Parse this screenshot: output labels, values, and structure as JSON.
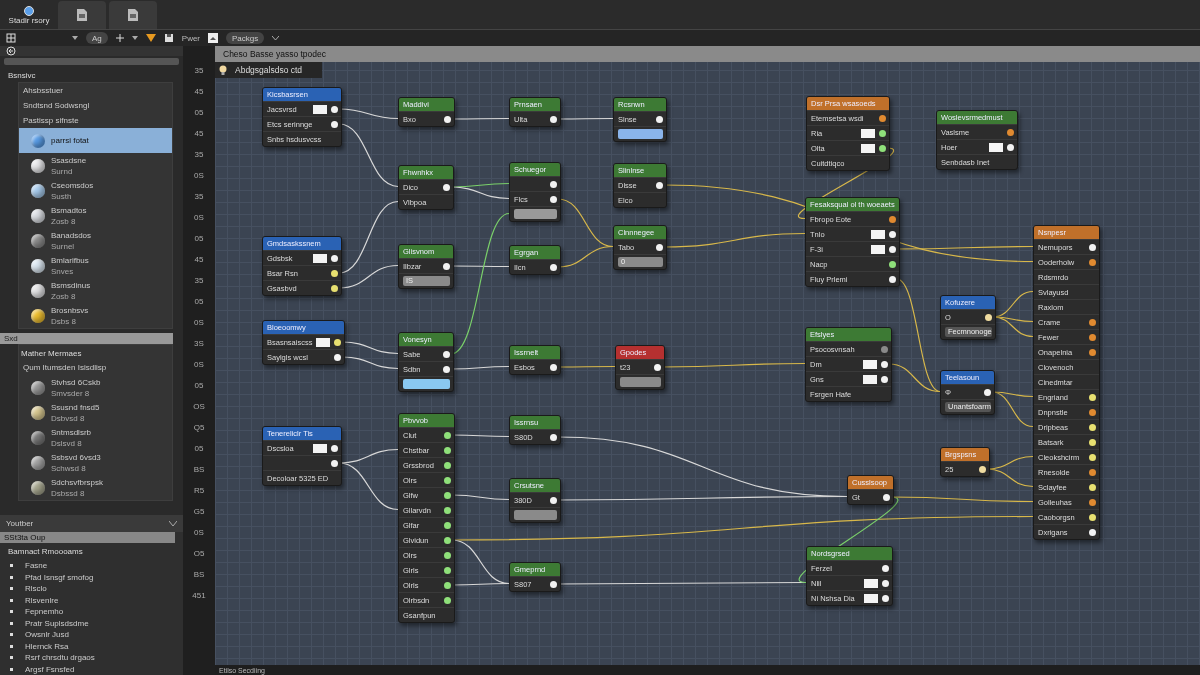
{
  "app_bar": {
    "title": "Stadir rsory"
  },
  "toolbar": {
    "zoom": "Ag",
    "toggle_label": "Pwer",
    "dropdown": "Packgs"
  },
  "left_panel": {
    "section": "Bsnsivc",
    "materials": [
      {
        "kind": "text",
        "name": "Ahsbsstuer",
        "selected": false
      },
      {
        "kind": "text",
        "name": "Sndtsnd Sodwsngl",
        "selected": false
      },
      {
        "kind": "text",
        "name": "Pastissp sifnste",
        "selected": false
      },
      {
        "kind": "sphere",
        "name": "parrsi fotat",
        "color": "#5a9ee8",
        "selected": true
      },
      {
        "kind": "sphere",
        "name": "Ssasdsne",
        "sub": "Surnd",
        "color": "#e8e8ea",
        "selected": false
      },
      {
        "kind": "sphere",
        "name": "Cseomsdos",
        "sub": "Susth",
        "color": "#a8ccee",
        "selected": false
      },
      {
        "kind": "sphere",
        "name": "Bsmadtos",
        "sub": "Zosb 8",
        "color": "#dcdfe4",
        "selected": false
      },
      {
        "kind": "sphere",
        "name": "Banadsdos",
        "sub": "Surnel",
        "color": "#8c8c8c",
        "selected": false
      },
      {
        "kind": "sphere",
        "name": "Bmlarifbus",
        "sub": "Snves",
        "color": "#dce8f2",
        "selected": false
      },
      {
        "kind": "sphere",
        "name": "Bsmsdinus",
        "sub": "Zosb 8",
        "color": "#e4e4e6",
        "selected": false
      },
      {
        "kind": "sphere",
        "name": "Brosnbsvs",
        "sub": "Dsbs 8",
        "color": "#f0c030",
        "selected": false
      }
    ]
  },
  "library": {
    "bar": "Sxd",
    "heading": "Mather Mermaes",
    "items": [
      {
        "kind": "text",
        "name": "Qum Itumsden Isisdlisp",
        "selected": false
      },
      {
        "kind": "sphere",
        "name": "Stvhsd 6Cskb",
        "sub": "Smvsder 8",
        "color": "#9a9a9a",
        "selected": false
      },
      {
        "kind": "sphere",
        "name": "Ssusnd fnsd5",
        "sub": "Dsbvsd 8",
        "color": "#d8c890",
        "selected": false
      },
      {
        "kind": "sphere",
        "name": "Sntmsdlsrb",
        "sub": "Dslsvd 8",
        "color": "#7a7a7a",
        "selected": false
      },
      {
        "kind": "sphere",
        "name": "Ssbsvd 6vsd3",
        "sub": "Schwsd 8",
        "color": "#a4a4a4",
        "selected": false
      },
      {
        "kind": "sphere",
        "name": "Sdchsvfbrspsk",
        "sub": "Dsbssd 8",
        "color": "#a8a890",
        "selected": false
      }
    ]
  },
  "notes_panel": {
    "title": "Youtber",
    "bar": "SSt3ta Oup",
    "heading": "Bamnact Rmoooams",
    "items": [
      "Fasne",
      "Pfad Isnsgf smofog",
      "Rlsclo",
      "Rlsvenlre",
      "Fepnemho",
      "Pratr Suplsdsdme",
      "Owsnlr Jusd",
      "Hlernck Rsa",
      "Rsrf chrsdtu drgaos",
      "Argsf Fsnsfed"
    ]
  },
  "ruler": [
    "35",
    "45",
    "05",
    "45",
    "35",
    "0S",
    "35",
    "0S",
    "05",
    "45",
    "35",
    "05",
    "0S",
    "3S",
    "0S",
    "05",
    "OS",
    "Q5",
    "05",
    "BS",
    "R5",
    "G5",
    "0S",
    "O5",
    "BS",
    "451"
  ],
  "canvas": {
    "breadcrumb": "Cheso Basse yasso tpodec",
    "subtitle": "Abdgsgalsdso ctd",
    "nodes": [
      {
        "title": "Kicsbasrsen",
        "color": "#2a62b4",
        "rows": [
          {
            "kind": "swatch",
            "label": "Jacsvrsd",
            "color": "#f2f2f2"
          },
          {
            "kind": "pin",
            "label": "Etcs serinnge",
            "color": "#f2f2f2"
          },
          {
            "kind": "text",
            "label": "Snbs hsdusvcss"
          }
        ]
      },
      {
        "title": "Maddivi",
        "color": "#3d7a34",
        "rows": [
          {
            "kind": "pin",
            "label": "Bxo",
            "color": "#f2f2f2"
          }
        ]
      },
      {
        "title": "Prnsaen",
        "color": "#3d7a34",
        "rows": [
          {
            "kind": "pin",
            "label": "Ulta",
            "color": "#f2f2f2"
          }
        ]
      },
      {
        "title": "Rcsnwn",
        "color": "#3d7a34",
        "rows": [
          {
            "kind": "pin",
            "label": "Slnse",
            "color": "#f2f2f2"
          },
          {
            "kind": "bar",
            "label": "",
            "color": "#8ab4ea"
          }
        ]
      },
      {
        "title": "Fhwnhkx",
        "color": "#3d7a34",
        "rows": [
          {
            "kind": "pin",
            "label": "Dico",
            "color": "#f2f2f2"
          },
          {
            "kind": "text",
            "label": "Vlbpoa"
          }
        ]
      },
      {
        "title": "Schuegor",
        "color": "#3d7a34",
        "rows": [
          {
            "kind": "pin",
            "label": "",
            "color": "#f2f2f2"
          },
          {
            "kind": "pin",
            "label": "Flcs",
            "color": "#f2f2f2"
          },
          {
            "kind": "bar",
            "label": "",
            "color": "#9a9a9a"
          }
        ]
      },
      {
        "title": "Slinlnse",
        "color": "#3d7a34",
        "rows": [
          {
            "kind": "pin",
            "label": "Dlsse",
            "color": "#f2f2f2"
          },
          {
            "kind": "text",
            "label": "Elco"
          }
        ]
      },
      {
        "title": "Gmdsaskssnem",
        "color": "#2a62b4",
        "rows": [
          {
            "kind": "swatch",
            "label": "Gdsbsk",
            "color": "#f2f2f2"
          },
          {
            "kind": "pin",
            "label": "Bsar Rsn",
            "color": "#e8e070"
          },
          {
            "kind": "pin",
            "label": "Gsasbvd",
            "color": "#e8e070"
          }
        ]
      },
      {
        "title": "Glisvnom",
        "color": "#3d7a34",
        "rows": [
          {
            "kind": "pin",
            "label": "Ilbzar",
            "color": "#f2f2f2"
          },
          {
            "kind": "bar",
            "label": "IS",
            "color": "#8a8a8a"
          }
        ]
      },
      {
        "title": "Egrgan",
        "color": "#3d7a34",
        "rows": [
          {
            "kind": "pin",
            "label": "Ilcn",
            "color": "#f2f2f2"
          }
        ]
      },
      {
        "title": "Clnnnegee",
        "color": "#3d7a34",
        "rows": [
          {
            "kind": "pin",
            "label": "Tabo",
            "color": "#f2f2f2"
          },
          {
            "kind": "bar",
            "label": "0",
            "color": "#8a8a8a"
          }
        ]
      },
      {
        "title": "Bloeoomwy",
        "color": "#2a62b4",
        "rows": [
          {
            "kind": "swatch",
            "label": "Bsasnsaiscss",
            "color": "#e8e070"
          },
          {
            "kind": "pin",
            "label": "Saylgls wcsl",
            "color": "#f2f2f2"
          }
        ]
      },
      {
        "title": "Vonesyn",
        "color": "#3d7a34",
        "rows": [
          {
            "kind": "pin",
            "label": "Sabe",
            "color": "#f2f2f2"
          },
          {
            "kind": "pin",
            "label": "Sdbn",
            "color": "#f2f2f2"
          },
          {
            "kind": "bar",
            "label": "",
            "color": "#8ac8f0"
          }
        ]
      },
      {
        "title": "Issrnelt",
        "color": "#3d7a34",
        "rows": [
          {
            "kind": "pin",
            "label": "Esbos",
            "color": "#f2f2f2"
          }
        ]
      },
      {
        "title": "Gpodes",
        "color": "#b53030",
        "rows": [
          {
            "kind": "pin",
            "label": "t23",
            "color": "#f2f2f2"
          },
          {
            "kind": "bar",
            "label": "",
            "color": "#8a8a8a"
          }
        ]
      },
      {
        "title": "Tenereliclr Tis",
        "color": "#2a62b4",
        "rows": [
          {
            "kind": "swatch",
            "label": "Dscsloa",
            "color": "#f2f2f2"
          },
          {
            "kind": "pin",
            "label": "",
            "color": "#f2f2f2"
          },
          {
            "kind": "text",
            "label": "Decoloar 5325 ED"
          }
        ]
      },
      {
        "title": "Pbvvob",
        "color": "#3d7a34",
        "rows": [
          {
            "kind": "pin",
            "label": "Clut",
            "color": "#8fe07a"
          },
          {
            "kind": "pin",
            "label": "Chstbar",
            "color": "#8fe07a"
          },
          {
            "kind": "pin",
            "label": "Grssbrod",
            "color": "#8fe07a"
          },
          {
            "kind": "pin",
            "label": "Olrs",
            "color": "#8fe07a"
          },
          {
            "kind": "pin",
            "label": "Glfw",
            "color": "#8fe07a"
          },
          {
            "kind": "pin",
            "label": "Gllarvdn",
            "color": "#8fe07a"
          },
          {
            "kind": "pin",
            "label": "Glfar",
            "color": "#8fe07a"
          },
          {
            "kind": "pin",
            "label": "Glvidun",
            "color": "#8fe07a"
          },
          {
            "kind": "pin",
            "label": "Olrs",
            "color": "#8fe07a"
          },
          {
            "kind": "pin",
            "label": "Glrls",
            "color": "#8fe07a"
          },
          {
            "kind": "pin",
            "label": "Olrls",
            "color": "#8fe07a"
          },
          {
            "kind": "pin",
            "label": "Olrbsdn",
            "color": "#8fe07a"
          },
          {
            "kind": "text",
            "label": "Gsanfpun"
          }
        ]
      },
      {
        "title": "Issrnsu",
        "color": "#3d7a34",
        "rows": [
          {
            "kind": "pin",
            "label": "S80D",
            "color": "#f2f2f2"
          }
        ]
      },
      {
        "title": "Crsutsne",
        "color": "#3d7a34",
        "rows": [
          {
            "kind": "pin",
            "label": "380D",
            "color": "#f2f2f2"
          },
          {
            "kind": "bar",
            "label": "",
            "color": "#8a8a8a"
          }
        ]
      },
      {
        "title": "Gmeprnd",
        "color": "#3d7a34",
        "rows": [
          {
            "kind": "pin",
            "label": "S807",
            "color": "#f2f2f2"
          }
        ]
      },
      {
        "title": "Dsr Prsa wsasoeds",
        "color": "#c0702a",
        "rows": [
          {
            "kind": "pin",
            "label": "Etemsetsa wsdi",
            "color": "#e08a30"
          },
          {
            "kind": "swatch",
            "label": "Ria",
            "color": "#8fe07a"
          },
          {
            "kind": "swatch",
            "label": "Olta",
            "color": "#8fe07a"
          },
          {
            "kind": "text",
            "label": "Cuitdtiqco"
          }
        ]
      },
      {
        "title": "Woslevsrmedmust",
        "color": "#3d7a34",
        "rows": [
          {
            "kind": "pin",
            "label": "Vaslsme",
            "color": "#e08a30"
          },
          {
            "kind": "swatch",
            "label": "Hoer",
            "color": "#f2f2f2"
          },
          {
            "kind": "text",
            "label": "Senbdasb Inet"
          }
        ]
      },
      {
        "title": "Fesaksqual ol th woeaets",
        "color": "#3d7a34",
        "rows": [
          {
            "kind": "pin",
            "label": "Fbropo Eote",
            "color": "#e08a30"
          },
          {
            "kind": "swatch",
            "label": "Tnlo",
            "color": "#f2f2f2"
          },
          {
            "kind": "swatch",
            "label": "F-3i",
            "color": "#f2f2f2"
          },
          {
            "kind": "pin",
            "label": "Nacp",
            "color": "#8fe07a"
          },
          {
            "kind": "pin",
            "label": "Fluy Prlemi",
            "color": "#f2f2f2"
          }
        ]
      },
      {
        "title": "Efslyes",
        "color": "#3d7a34",
        "rows": [
          {
            "kind": "pin",
            "label": "Psocosvnsah",
            "color": "#8a8a8a"
          },
          {
            "kind": "swatch",
            "label": "Dm",
            "color": "#f2f2f2"
          },
          {
            "kind": "swatch",
            "label": "Gns",
            "color": "#f2f2f2"
          },
          {
            "kind": "text",
            "label": "Fsrgen Hafe"
          }
        ]
      },
      {
        "title": "Kofuzere",
        "color": "#2a62b4",
        "rows": [
          {
            "kind": "pin",
            "label": "O",
            "color": "#f0dca0"
          },
          {
            "kind": "bar",
            "label": "Fecmnonoge",
            "color": "#555555"
          }
        ]
      },
      {
        "title": "Teelasoun",
        "color": "#2a62b4",
        "rows": [
          {
            "kind": "pin",
            "label": "Φ",
            "color": "#f2f2f2"
          },
          {
            "kind": "bar",
            "label": "Unantsfoarm",
            "color": "#555555"
          }
        ]
      },
      {
        "title": "Brgspsns",
        "color": "#c0702a",
        "rows": [
          {
            "kind": "pin",
            "label": "25",
            "color": "#f0dca0"
          }
        ]
      },
      {
        "title": "Cusslsoop",
        "color": "#c0702a",
        "rows": [
          {
            "kind": "pin",
            "label": "Gt",
            "color": "#f2f2f2"
          }
        ]
      },
      {
        "title": "Nordsgrsed",
        "color": "#3d7a34",
        "rows": [
          {
            "kind": "pin",
            "label": "Ferzel",
            "color": "#f2f2f2"
          },
          {
            "kind": "swatch",
            "label": "Nlil",
            "color": "#f2f2f2"
          },
          {
            "kind": "swatch",
            "label": "Ni Nshsa Dia",
            "color": "#f2f2f2"
          }
        ]
      },
      {
        "title": "Nsnpesr",
        "color": "#c0702a",
        "rows": [
          {
            "kind": "pin",
            "label": "Nemupors",
            "color": "#f2f2f2"
          },
          {
            "kind": "pin",
            "label": "Ooderholw",
            "color": "#e08a30"
          },
          {
            "kind": "text",
            "label": "Rdsmrdo"
          },
          {
            "kind": "text",
            "label": "Svlayusd"
          },
          {
            "kind": "text",
            "label": "Raxlom"
          },
          {
            "kind": "pin",
            "label": "Crame",
            "color": "#e08a30"
          },
          {
            "kind": "pin",
            "label": "Fewer",
            "color": "#e08a30"
          },
          {
            "kind": "pin",
            "label": "Onapelnia",
            "color": "#e08a30"
          },
          {
            "kind": "text",
            "label": "Clovenoch"
          },
          {
            "kind": "text",
            "label": "Cinedmtar"
          },
          {
            "kind": "pin",
            "label": "Engriand",
            "color": "#e8e070"
          },
          {
            "kind": "pin",
            "label": "Dnpnstle",
            "color": "#e08a30"
          },
          {
            "kind": "pin",
            "label": "Dripbeas",
            "color": "#e8e070"
          },
          {
            "kind": "pin",
            "label": "Batsark",
            "color": "#e8e070"
          },
          {
            "kind": "pin",
            "label": "Cleokshcirm",
            "color": "#e8e070"
          },
          {
            "kind": "pin",
            "label": "Rnesolde",
            "color": "#e08a30"
          },
          {
            "kind": "pin",
            "label": "Sclayfee",
            "color": "#e8e070"
          },
          {
            "kind": "pin",
            "label": "Golleuhas",
            "color": "#e08a30"
          },
          {
            "kind": "pin",
            "label": "Caoborgsn",
            "color": "#e8e070"
          },
          {
            "kind": "pin",
            "label": "Dxrigans",
            "color": "#f2f2f2"
          }
        ]
      }
    ]
  },
  "status_bar": "Etilso Secdiing"
}
